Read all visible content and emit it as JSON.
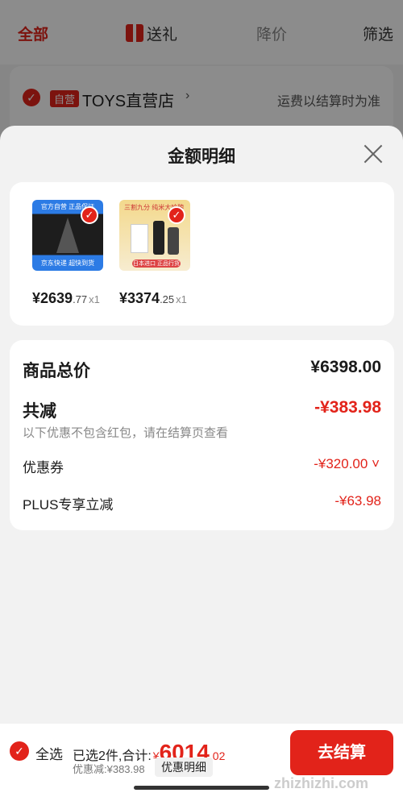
{
  "topbar": {
    "tab_all": "全部",
    "tab_gift": "送礼",
    "tab_drop": "降价",
    "tab_filter": "筛选"
  },
  "store": {
    "badge": "自营",
    "name": "TOYS直营店",
    "freight": "运费以结算时为准"
  },
  "sheet": {
    "title": "金额明细",
    "products": [
      {
        "price": "¥2639",
        "price_dec": ".77",
        "qty": "x1",
        "thumb_top": "官方自营 正品保证",
        "thumb_band": "京东快递 超快到货"
      },
      {
        "price": "¥3374",
        "price_dec": ".25",
        "qty": "x1",
        "thumb_top": "三割九分 纯米大吟酿",
        "thumb_band": "日本进口 正品行货"
      }
    ],
    "summary": {
      "total_label": "商品总价",
      "total_value": "¥6398.00",
      "reduce_label": "共减",
      "reduce_value": "-¥383.98",
      "note": "以下优惠不包含红包，请在结算页查看",
      "coupon_label": "优惠券",
      "coupon_value": "-¥320.00",
      "plus_label": "PLUS专享立减",
      "plus_value": "-¥63.98"
    }
  },
  "bottombar": {
    "select_all": "全选",
    "selected_text": "已选2件,合计:",
    "yen": "¥",
    "amount_int": "6014",
    "amount_dec": ".02",
    "discount_text": "优惠减:¥383.98",
    "detail_button": "优惠明细",
    "checkout": "去结算",
    "watermark": "zhizhizhi.com"
  },
  "colors": {
    "accent": "#e2231a"
  }
}
